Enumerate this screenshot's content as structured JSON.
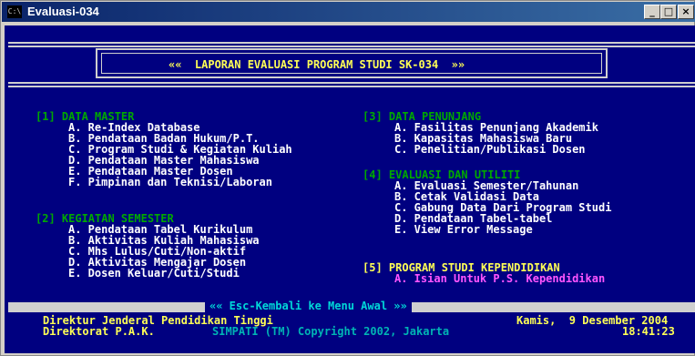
{
  "window": {
    "title": "Evaluasi-034",
    "icon_label": "C:\\",
    "minimize_label": "_",
    "maximize_label": "□",
    "close_label": "×"
  },
  "header": {
    "banner": "««  LAPORAN EVALUASI PROGRAM STUDI SK-034  »»"
  },
  "sections": {
    "master": {
      "title": "[1] DATA MASTER",
      "items": [
        "A. Re-Index Database",
        "B. Pendataan Badan Hukum/P.T.",
        "C. Program Studi & Kegiatan Kuliah",
        "D. Pendataan Master Mahasiswa",
        "E. Pendataan Master Dosen",
        "F. Pimpinan dan Teknisi/Laboran"
      ]
    },
    "kegiatan": {
      "title": "[2] KEGIATAN SEMESTER",
      "items": [
        "A. Pendataan Tabel Kurikulum",
        "B. Aktivitas Kuliah Mahasiswa",
        "C. Mhs Lulus/Cuti/Non-aktif",
        "D. Aktivitas Mengajar Dosen",
        "E. Dosen Keluar/Cuti/Studi"
      ]
    },
    "penunjang": {
      "title": "[3] DATA PENUNJANG",
      "items": [
        "A. Fasilitas Penunjang Akademik",
        "B. Kapasitas Mahasiswa Baru",
        "C. Penelitian/Publikasi Dosen"
      ]
    },
    "evaluasi": {
      "title": "[4] EVALUASI DAN UTILITI",
      "items": [
        "A. Evaluasi Semester/Tahunan",
        "B. Cetak Validasi Data",
        "C. Gabung Data Dari Program Studi",
        "D. Pendataan Tabel-tabel",
        "E. View Error Message"
      ]
    },
    "kependidikan": {
      "title": "[5] PROGRAM STUDI KEPENDIDIKAN",
      "items": [
        "A. Isian Untuk P.S. Kependidikan"
      ]
    }
  },
  "footer": {
    "esc_label": "«« Esc-Kembali ke Menu Awal »»",
    "org_line1": "Direktur Jenderal Pendidikan Tinggi",
    "org_line2": "Direktorat P.A.K.",
    "copyright": "SIMPATI (TM) Copyright 2002, Jakarta",
    "date": "Kamis,  9 Desember 2004",
    "time": "18:41:23"
  },
  "colors": {
    "console_bg": "#000080",
    "menu_item": "#ffffff",
    "section_title": "#00a800",
    "highlight": "#ffff55",
    "accent": "#00b4b4",
    "magenta": "#ff55ff"
  }
}
